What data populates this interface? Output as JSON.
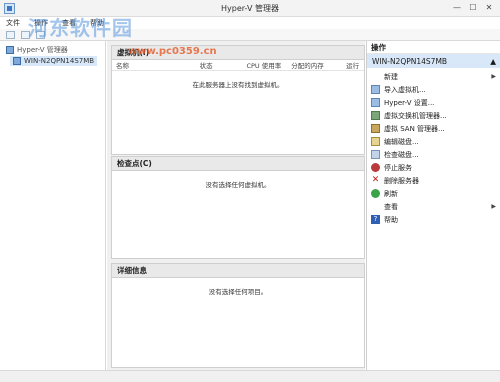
{
  "window": {
    "title": "Hyper-V 管理器"
  },
  "menu": [
    "文件",
    "操作",
    "查看",
    "帮助"
  ],
  "tree": {
    "root": "Hyper-V 管理器",
    "server": "WIN-N2QPN14S7MB"
  },
  "vm_panel": {
    "title": "虚拟机(I)",
    "columns": [
      "名称",
      "状态",
      "CPU 使用率",
      "分配的内存",
      "运行"
    ],
    "empty": "在此服务器上没有找到虚拟机。"
  },
  "checkpoint_panel": {
    "title": "检查点(C)",
    "empty": "没有选择任何虚拟机。"
  },
  "details_panel": {
    "title": "详细信息",
    "empty": "没有选择任何项目。"
  },
  "actions": {
    "title": "操作",
    "host": "WIN-N2QPN14S7MB",
    "items": [
      {
        "label": "新建",
        "icon": "blank",
        "submenu": true
      },
      {
        "label": "导入虚拟机...",
        "icon": "import-icon"
      },
      {
        "label": "Hyper-V 设置...",
        "icon": "settings-icon"
      },
      {
        "label": "虚拟交换机管理器...",
        "icon": "switch-icon"
      },
      {
        "label": "虚拟 SAN 管理器...",
        "icon": "san-icon"
      },
      {
        "label": "编辑磁盘...",
        "icon": "edit-disk-icon"
      },
      {
        "label": "检查磁盘...",
        "icon": "inspect-disk-icon"
      },
      {
        "label": "停止服务",
        "icon": "stop-icon"
      },
      {
        "label": "删除服务器",
        "icon": "delete-icon"
      },
      {
        "label": "刷新",
        "icon": "refresh-icon"
      },
      {
        "label": "查看",
        "icon": "blank",
        "submenu": true
      },
      {
        "label": "帮助",
        "icon": "help-icon"
      }
    ]
  },
  "watermark": {
    "text": "河东软件园",
    "url": "www.pc0359.cn"
  }
}
